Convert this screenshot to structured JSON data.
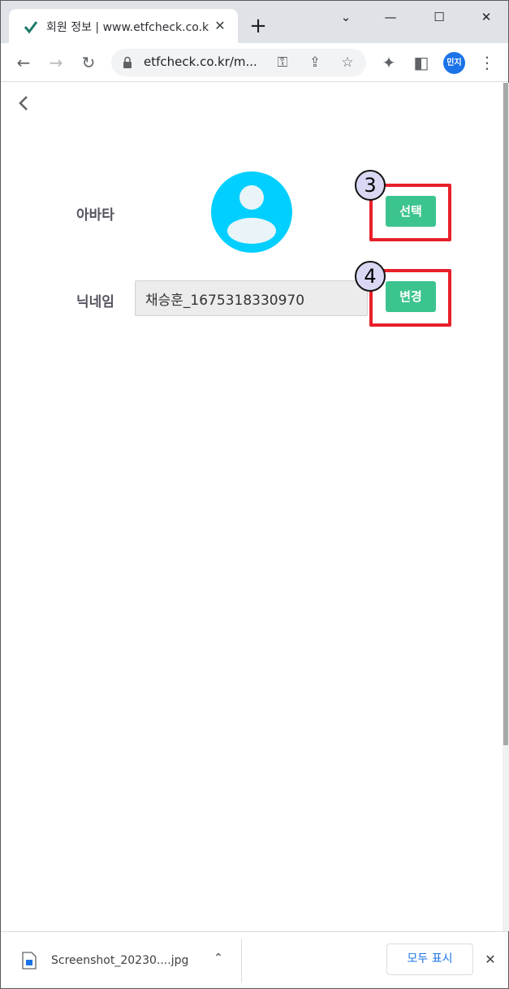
{
  "browser": {
    "tab_title": "회원 정보 | www.etfcheck.co.kr",
    "tab_close": "✕",
    "new_tab": "+",
    "url": "etfcheck.co.kr/m...",
    "profile_label": "민지"
  },
  "page": {
    "avatar_label": "아바타",
    "nickname_label": "닉네임",
    "nickname_value": "채승훈_1675318330970",
    "select_button": "선택",
    "change_button": "변경",
    "annotation_3": "3",
    "annotation_4": "4"
  },
  "colors": {
    "accent_green": "#3cc48f",
    "avatar_cyan": "#00cfff",
    "highlight_red": "#e8202a"
  },
  "download_shelf": {
    "file_name": "Screenshot_20230....jpg",
    "show_all": "모두 표시",
    "close": "✕"
  },
  "icons": [
    "back-arrow-icon",
    "forward-arrow-icon",
    "reload-icon",
    "lock-icon",
    "key-icon",
    "share-icon",
    "star-icon",
    "extensions-icon",
    "sidepanel-icon",
    "menu-icon",
    "chevron-left-icon",
    "user-icon",
    "image-file-icon",
    "chevron-up-icon",
    "close-icon"
  ]
}
